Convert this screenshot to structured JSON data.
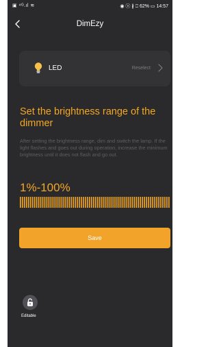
{
  "status_bar": {
    "left_text": "▣ ⁴ᴳ.ıl ≋",
    "right_text": "◉ ⓥ ∦ ⎕ 62% ▭ 14:57"
  },
  "header": {
    "back_icon": "chevron-left-icon",
    "title": "DimEzy"
  },
  "device_card": {
    "icon": "light-bulb-icon",
    "name": "LED",
    "action_label": "Reselect",
    "action_icon": "chevron-right-icon"
  },
  "heading": "Set the brightness range of the dimmer",
  "instructions": "After setting the brightness range, dim and switch the lamp. If the light flashes and goes out during operation, increase the minimum brightness until it does not flash and go out.",
  "range": {
    "display": "1%-100%",
    "min_percent": 1,
    "max_percent": 100
  },
  "save_button": {
    "label": "Save"
  },
  "lock": {
    "icon": "unlocked-padlock-icon",
    "label": "Editable"
  },
  "colors": {
    "background": "#2a2a2c",
    "card": "#333336",
    "accent": "#f3a724",
    "button": "#f2a42a",
    "muted_text": "#5f5f63"
  }
}
